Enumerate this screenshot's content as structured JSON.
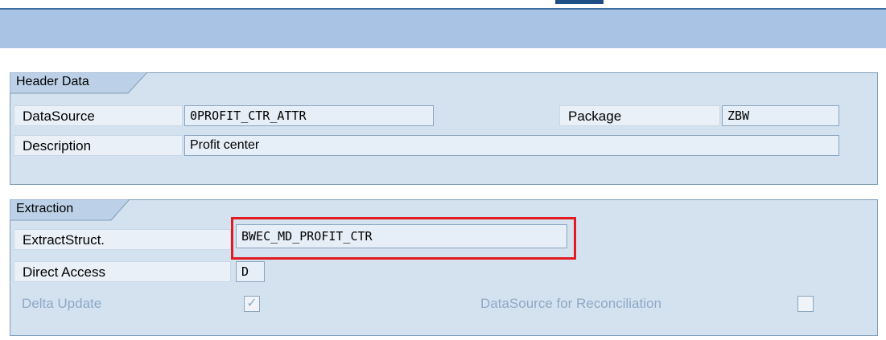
{
  "header_group": {
    "title": "Header Data",
    "datasource_label": "DataSource",
    "datasource_value": "0PROFIT_CTR_ATTR",
    "package_label": "Package",
    "package_value": "ZBW",
    "description_label": "Description",
    "description_value": "Profit center"
  },
  "extraction_group": {
    "title": "Extraction",
    "extractstruct_label": "ExtractStruct.",
    "extractstruct_value": "BWEC_MD_PROFIT_CTR",
    "direct_access_label": "Direct Access",
    "direct_access_value": "D",
    "delta_update_label": "Delta Update",
    "delta_update_checked": true,
    "reconciliation_label": "DataSource for Reconciliation",
    "reconciliation_checked": false
  },
  "highlight_color": "#e11b22",
  "toolbar_color": "#a8c3e3",
  "group_bg_color": "#d4e2f0"
}
